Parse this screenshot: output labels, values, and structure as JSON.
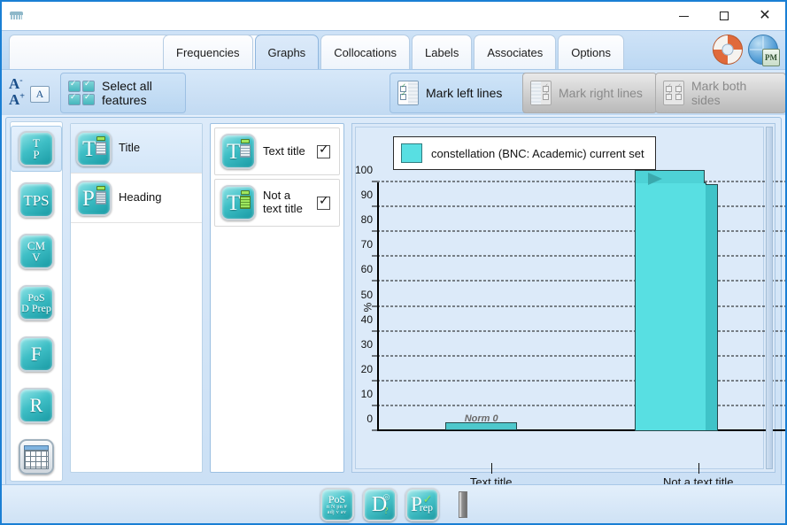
{
  "window": {
    "title": "",
    "system_icon": "app-icon",
    "controls": {
      "minimize": "–",
      "maximize": "□",
      "close": "✕"
    }
  },
  "tabs": [
    {
      "label": "Frequencies",
      "active": false
    },
    {
      "label": "Graphs",
      "active": true
    },
    {
      "label": "Collocations",
      "active": false
    },
    {
      "label": "Labels",
      "active": false
    },
    {
      "label": "Associates",
      "active": false
    },
    {
      "label": "Options",
      "active": false
    }
  ],
  "top_right_icons": [
    {
      "name": "help-lifering-icon",
      "label": ""
    },
    {
      "name": "globe-pm-icon",
      "label": "PM"
    }
  ],
  "ribbon": {
    "font_decrease": "A",
    "font_decrease_sup": "-",
    "font_increase": "A",
    "font_increase_sup": "+",
    "font_box": "A",
    "select_all_features": "Select all features",
    "mark_left_lines": "Mark left lines",
    "mark_right_lines": "Mark right lines",
    "mark_both_sides": "Mark both sides"
  },
  "rail": [
    {
      "name": "tp-tool",
      "line1": "T",
      "line2": "P",
      "selected": true
    },
    {
      "name": "tps-tool",
      "text": "TPS",
      "selected": false
    },
    {
      "name": "cmv-tool",
      "line1": "CM",
      "line2": "V",
      "selected": false
    },
    {
      "name": "pos-dprep-tool",
      "line1": "PoS",
      "line2": "D Prep",
      "selected": false
    },
    {
      "name": "f-tool",
      "text": "F",
      "selected": false
    },
    {
      "name": "r-tool",
      "text": "R",
      "selected": false
    },
    {
      "name": "table-tool",
      "text": "",
      "selected": false
    }
  ],
  "panel_features": {
    "items": [
      {
        "label": "Title",
        "icon": "title-doc-icon",
        "selected": true
      },
      {
        "label": "Heading",
        "icon": "heading-doc-icon",
        "selected": false
      }
    ]
  },
  "panel_values": {
    "items": [
      {
        "label": "Text title",
        "icon": "text-title-icon",
        "checked": true
      },
      {
        "label": "Not a text title",
        "icon": "not-a-text-title-icon",
        "checked": true
      }
    ]
  },
  "chart_data": {
    "type": "bar",
    "title": "",
    "legend": [
      {
        "label": "constellation (BNC: Academic) current set",
        "color": "#58dfe2"
      }
    ],
    "legend_position": "top-left",
    "categories": [
      "Text title",
      "Not a text title"
    ],
    "values": [
      0,
      100
    ],
    "point_labels": [
      "Norm 0",
      ""
    ],
    "xlabel": "",
    "ylabel": "%",
    "ylim": [
      0,
      100
    ],
    "yticks": [
      0,
      10,
      20,
      30,
      40,
      50,
      60,
      70,
      80,
      90,
      100
    ],
    "grid": true,
    "series": [
      {
        "name": "constellation (BNC: Academic) current set",
        "values": [
          0,
          100
        ],
        "color": "#58dfe2"
      }
    ]
  },
  "bottom_bar": {
    "buttons": [
      {
        "name": "pos-tags-button",
        "l1": "PoS",
        "l2": "n  N pn #",
        "l3": "adj  v  av"
      },
      {
        "name": "dictionary-button",
        "letter": "D"
      },
      {
        "name": "prep-button",
        "letter": "P",
        "suffix": "rep"
      }
    ],
    "handle": "splitter-handle"
  }
}
